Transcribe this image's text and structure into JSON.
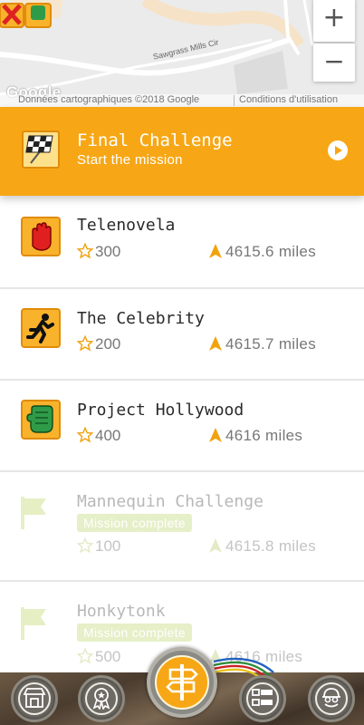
{
  "map": {
    "street_label": "Sawgrass Mills Cir",
    "google_logo": "Google",
    "attribution": "Données cartographiques ©2018 Google",
    "terms": "Conditions d'utilisation",
    "zoom_in": "+",
    "zoom_out": "−"
  },
  "banner": {
    "title": "Final Challenge",
    "subtitle": "Start the mission",
    "icon": "checkered-flag-icon",
    "color": "#f7a715"
  },
  "missions": [
    {
      "name": "Telenovela",
      "points": "300",
      "distance": "4615.6 miles",
      "icon": "hand-stop-icon",
      "complete": false
    },
    {
      "name": "The Celebrity",
      "points": "200",
      "distance": "4615.7 miles",
      "icon": "running-figure-icon",
      "complete": false
    },
    {
      "name": "Project Hollywood",
      "points": "400",
      "distance": "4616 miles",
      "icon": "thumbs-up-icon",
      "complete": false
    },
    {
      "name": "Mannequin Challenge",
      "badge": "Mission complete",
      "points": "100",
      "distance": "4615.8 miles",
      "icon": "flag-icon",
      "complete": true
    },
    {
      "name": "Honkytonk",
      "badge": "Mission complete",
      "points": "500",
      "distance": "4616 miles",
      "icon": "flag-icon",
      "complete": true
    }
  ],
  "nav": {
    "items": [
      "store-icon",
      "award-ribbon-icon",
      "signpost-icon",
      "checklist-icon",
      "agent-profile-icon"
    ]
  },
  "colors": {
    "accent": "#f7a715",
    "complete_badge": "#e5efc8",
    "complete_flag": "#e6efc4"
  }
}
